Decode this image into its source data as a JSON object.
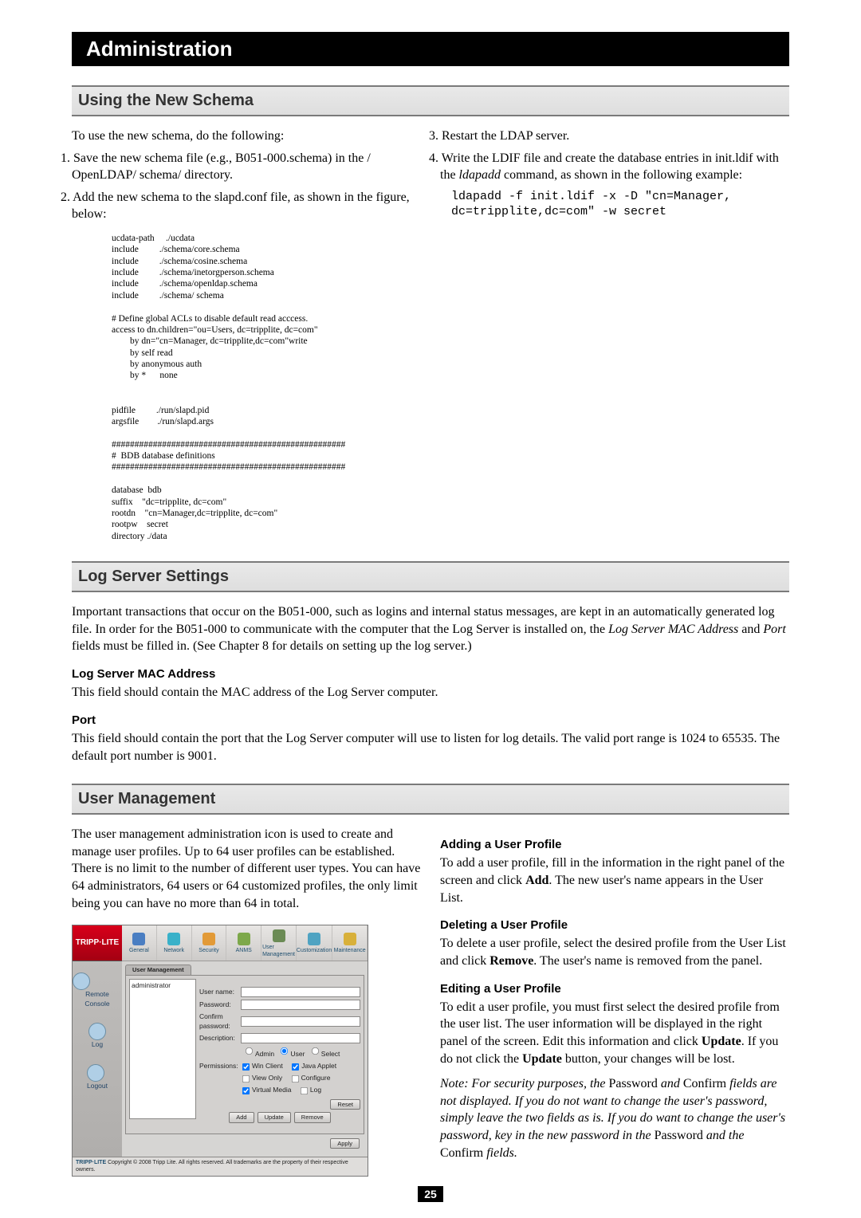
{
  "banner": "Administration",
  "sec1": {
    "title": "Using the New Schema"
  },
  "left1": {
    "intro": "To use the new schema, do the following:",
    "n1": "1. Save the new schema file (e.g., B051-000.schema) in the / OpenLDAP/ schema/ directory.",
    "n2": "2. Add the new schema to the slapd.conf file, as shown in the figure, below:"
  },
  "right1": {
    "n3": "3. Restart the LDAP server.",
    "n4a": "4. Write the LDIF file and create the database entries in init.ldif with the ",
    "n4b": "ldapadd",
    "n4c": " command, as shown in the following example:",
    "code1": "ldapadd -f init.ldif -x -D \"cn=Manager,",
    "code2": "dc=tripplite,dc=com\" -w secret"
  },
  "conf": "ucdata-path     ./ucdata\ninclude         ./schema/core.schema\ninclude         ./schema/cosine.schema\ninclude         ./schema/inetorgperson.schema\ninclude         ./schema/openldap.schema\ninclude         ./schema/ schema\n\n# Define global ACLs to disable default read acccess.\naccess to dn.children=\"ou=Users, dc=tripplite, dc=com\"\n        by dn=\"cn=Manager, dc=tripplite,dc=com\"write\n        by self read\n        by anonymous auth\n        by *      none\n\n\npidfile         ./run/slapd.pid\nargsfile        ./run/slapd.args\n\n###################################################\n#  BDB database definitions\n###################################################\n\ndatabase  bdb\nsuffix    \"dc=tripplite, dc=com\"\nrootdn    \"cn=Manager,dc=tripplite, dc=com\"\nrootpw    secret\ndirectory ./data",
  "sec2": {
    "title": "Log Server Settings",
    "p1a": "Important transactions that occur on the B051-000, such as logins and internal status messages, are kept in an automatically generated log file. In order for the B051-000 to communicate with the computer that the Log Server is installed on, the ",
    "p1b": "Log Server MAC Address",
    "p1c": " and ",
    "p1d": "Port",
    "p1e": " fields must be filled in. (See Chapter 8 for details on setting up the log server.)",
    "h_mac": "Log Server MAC Address",
    "p_mac": "This field should contain the MAC address of the Log Server computer.",
    "h_port": "Port",
    "p_port": "This field should contain the port that the Log Server computer will use to listen for log details. The valid port range is 1024 to 65535. The default port number is 9001."
  },
  "sec3": {
    "title": "User Management"
  },
  "left3": {
    "p": "The user management administration icon is used to create and manage user profiles. Up to 64 user profiles can be established. There is no limit to the number of different user types. You can have 64 administrators, 64 users or 64 customized profiles, the only limit being you can have no more than 64 in total."
  },
  "right3": {
    "h_add": "Adding a User Profile",
    "p_add_a": "To add a user profile, fill in the information in the right panel of the screen and click ",
    "p_add_b": "Add",
    "p_add_c": ". The new user's name appears in the User List.",
    "h_del": "Deleting a User Profile",
    "p_del_a": "To delete a user profile, select the desired profile from the User List and click ",
    "p_del_b": "Remove",
    "p_del_c": ". The user's name is removed from the panel.",
    "h_edit": "Editing a User Profile",
    "p_edit_a": "To edit a user profile, you must first select the desired profile from the user list. The user information will be displayed in the right panel of the screen. Edit this information and click ",
    "p_edit_b": "Update",
    "p_edit_c": ". If you do not click the ",
    "p_edit_d": "Update",
    "p_edit_e": " button, your changes will be lost.",
    "note_a": "Note: For security purposes, the ",
    "note_b": "Password",
    "note_c": " and ",
    "note_d": "Confirm",
    "note_e": " fields are not displayed. If you do not want to change the user's password, simply leave the two fields as is. If you do want to change the user's password, key in the new password in the ",
    "note_f": "Password",
    "note_g": " and the ",
    "note_h": "Confirm",
    "note_i": " fields."
  },
  "screenshot": {
    "logo": "TRIPP·LITE",
    "menu": [
      "General",
      "Network",
      "Security",
      "ANMS",
      "User\nManagement",
      "Customization",
      "Maintenance"
    ],
    "tab": "User Management",
    "admin": "administrator",
    "side": [
      "Remote Console",
      "Log",
      "Logout"
    ],
    "labels": {
      "un": "User name:",
      "pw": "Password:",
      "cp": "Confirm\npassword:",
      "de": "Description:",
      "perm": "Permissions:"
    },
    "rads": {
      "admin": "Admin",
      "user": "User",
      "sel": "Select"
    },
    "cks": {
      "wc": "Win Client",
      "ja": "Java Applet",
      "vu": "View Only",
      "cf": "Configure",
      "vm": "Virtual Media",
      "lg": "Log"
    },
    "btns": {
      "reset": "Reset",
      "add": "Add",
      "update": "Update",
      "remove": "Remove",
      "apply": "Apply"
    },
    "footer": "Copyright © 2008 Tripp Lite. All rights reserved. All trademarks are the property of their respective owners.",
    "flogo": "TRIPP·LITE"
  },
  "page_num": "25"
}
